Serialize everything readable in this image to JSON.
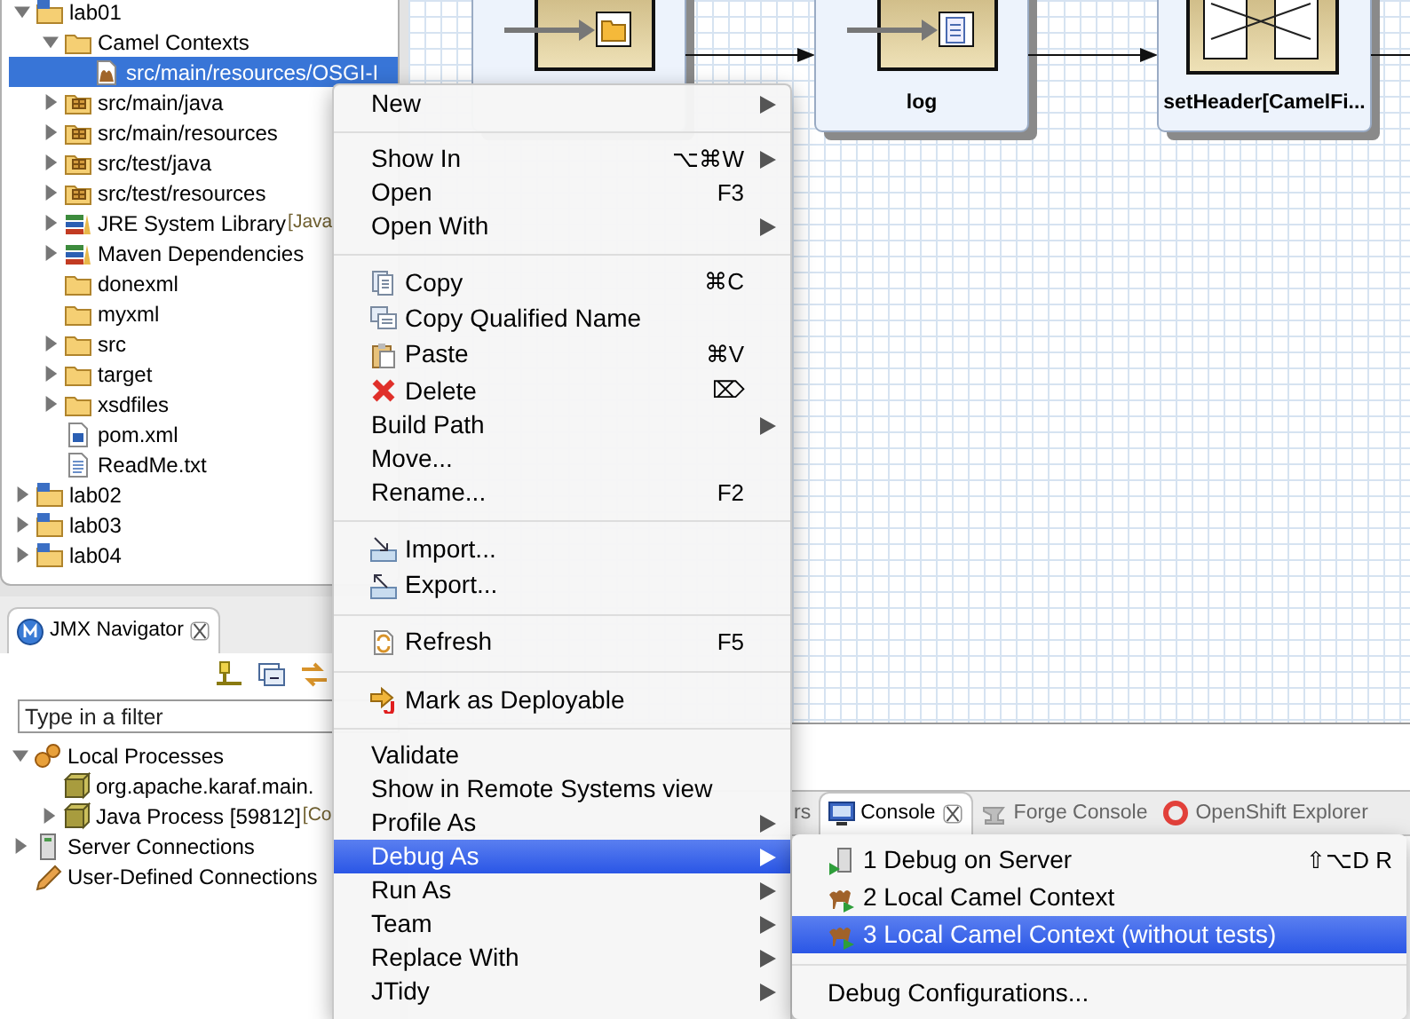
{
  "project_explorer": {
    "items": [
      {
        "label": "lab01",
        "kind": "project",
        "expanded": true,
        "selected": false,
        "children": [
          {
            "label": "Camel Contexts",
            "kind": "folder",
            "expanded": true,
            "selected": false,
            "children": [
              {
                "label": "src/main/resources/OSGI-I",
                "kind": "camel-file",
                "selected": true
              }
            ]
          },
          {
            "label": "src/main/java",
            "kind": "package-folder",
            "expanded": false,
            "selected": false
          },
          {
            "label": "src/main/resources",
            "kind": "package-folder",
            "expanded": false,
            "selected": false
          },
          {
            "label": "src/test/java",
            "kind": "package-folder",
            "expanded": false,
            "selected": false
          },
          {
            "label": "src/test/resources",
            "kind": "package-folder",
            "expanded": false,
            "selected": false
          },
          {
            "label": "JRE System Library",
            "decoration": "[Java",
            "kind": "library",
            "expanded": false,
            "selected": false
          },
          {
            "label": "Maven Dependencies",
            "kind": "library",
            "expanded": false,
            "selected": false
          },
          {
            "label": "donexml",
            "kind": "folder",
            "selected": false
          },
          {
            "label": "myxml",
            "kind": "folder",
            "selected": false
          },
          {
            "label": "src",
            "kind": "folder",
            "expanded": false,
            "selected": false
          },
          {
            "label": "target",
            "kind": "folder",
            "expanded": false,
            "selected": false
          },
          {
            "label": "xsdfiles",
            "kind": "folder",
            "expanded": false,
            "selected": false
          },
          {
            "label": "pom.xml",
            "kind": "pom",
            "selected": false
          },
          {
            "label": "ReadMe.txt",
            "kind": "text-file",
            "selected": false
          }
        ]
      },
      {
        "label": "lab02",
        "kind": "project",
        "expanded": false,
        "selected": false
      },
      {
        "label": "lab03",
        "kind": "project",
        "expanded": false,
        "selected": false
      },
      {
        "label": "lab04",
        "kind": "project",
        "expanded": false,
        "selected": false
      }
    ]
  },
  "jmx_navigator": {
    "tab": "JMX Navigator",
    "filter": {
      "placeholder": "Type in a filter"
    },
    "items": [
      {
        "label": "Local Processes",
        "kind": "gears",
        "expanded": true,
        "selected": false,
        "children": [
          {
            "label": "org.apache.karaf.main.",
            "kind": "process",
            "selected": false
          },
          {
            "label": "Java Process [59812]",
            "decoration": "[Co",
            "kind": "process",
            "expanded": false,
            "selected": false
          }
        ]
      },
      {
        "label": "Server Connections",
        "kind": "server",
        "expanded": false,
        "selected": false
      },
      {
        "label": "User-Defined Connections",
        "kind": "pencil",
        "selected": false
      }
    ]
  },
  "diagram": {
    "nodes": [
      {
        "kind": "folder"
      },
      {
        "kind": "document",
        "label": "log"
      },
      {
        "kind": "split",
        "label": "setHeader[CamelFi..."
      }
    ]
  },
  "bottom_tabs": [
    {
      "label": "rs",
      "selected": false
    },
    {
      "label": "Console",
      "kind": "console",
      "selected": true
    },
    {
      "label": "Forge Console",
      "kind": "forge",
      "selected": false
    },
    {
      "label": "OpenShift Explorer",
      "kind": "openshift",
      "selected": false
    }
  ],
  "context_menu": {
    "groups": [
      [
        {
          "label": "New",
          "submenu": true,
          "selected": false
        }
      ],
      [
        {
          "label": "Show In",
          "shortcut": "⌥⌘W",
          "submenu": true,
          "selected": false
        },
        {
          "label": "Open",
          "shortcut": "F3",
          "submenu": false,
          "selected": false
        },
        {
          "label": "Open With",
          "submenu": true,
          "selected": false
        }
      ],
      [
        {
          "label": "Copy",
          "kind": "copy",
          "shortcut": "⌘C",
          "submenu": false,
          "selected": false
        },
        {
          "label": "Copy Qualified Name",
          "kind": "copy-name",
          "submenu": false,
          "selected": false
        },
        {
          "label": "Paste",
          "kind": "paste",
          "shortcut": "⌘V",
          "submenu": false,
          "selected": false
        },
        {
          "label": "Delete",
          "kind": "delete",
          "shortcut": "⌦",
          "submenu": false,
          "selected": false
        },
        {
          "label": "Build Path",
          "submenu": true,
          "selected": false
        },
        {
          "label": "Move...",
          "submenu": false,
          "selected": false
        },
        {
          "label": "Rename...",
          "shortcut": "F2",
          "submenu": false,
          "selected": false
        }
      ],
      [
        {
          "label": "Import...",
          "kind": "import",
          "submenu": false,
          "selected": false
        },
        {
          "label": "Export...",
          "kind": "export",
          "submenu": false,
          "selected": false
        }
      ],
      [
        {
          "label": "Refresh",
          "kind": "refresh",
          "shortcut": "F5",
          "submenu": false,
          "selected": false
        }
      ],
      [
        {
          "label": "Mark as Deployable",
          "kind": "deploy",
          "submenu": false,
          "selected": false
        }
      ],
      [
        {
          "label": "Validate",
          "submenu": false,
          "selected": false
        },
        {
          "label": "Show in Remote Systems view",
          "submenu": false,
          "selected": false
        },
        {
          "label": "Profile As",
          "submenu": true,
          "selected": false
        },
        {
          "label": "Debug As",
          "submenu": true,
          "selected": true
        },
        {
          "label": "Run As",
          "submenu": true,
          "selected": false
        },
        {
          "label": "Team",
          "submenu": true,
          "selected": false
        },
        {
          "label": "Replace With",
          "submenu": true,
          "selected": false
        },
        {
          "label": "JTidy",
          "submenu": true,
          "selected": false
        }
      ]
    ]
  },
  "debug_submenu": {
    "groups": [
      [
        {
          "label": "1 Debug on Server",
          "kind": "server-debug",
          "shortcut": "⇧⌥D R",
          "selected": false
        },
        {
          "label": "2 Local Camel Context",
          "kind": "camel",
          "selected": false
        },
        {
          "label": "3 Local Camel Context (without tests)",
          "kind": "camel",
          "selected": true
        }
      ],
      [
        {
          "label": "Debug Configurations...",
          "selected": false
        }
      ]
    ]
  }
}
